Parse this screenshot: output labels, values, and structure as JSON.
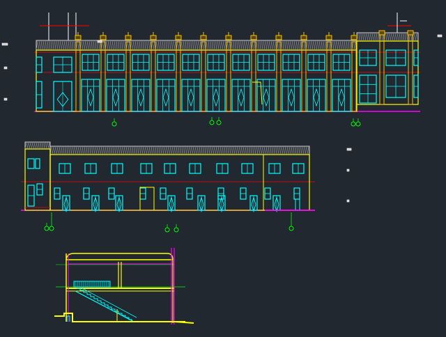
{
  "drawing": {
    "background": "#212830",
    "palette": {
      "wall": "#ffff00",
      "window": "#00ffff",
      "column": "#ffc000",
      "axis": "#ff0000",
      "ground": "#ff00ff",
      "roof": "#d0d0d0",
      "dim": "#00ff00",
      "text": "#ffffff"
    }
  },
  "views": {
    "front_elevation": {
      "front_bays": 11,
      "side_bays": 2,
      "axis_markers": [
        "1",
        "2",
        "3",
        "4",
        "5"
      ]
    },
    "rear_elevation": {
      "upper_windows": 10,
      "door_groups": 9,
      "axis_markers": [
        "1",
        "2",
        "3",
        "4"
      ]
    },
    "section": {
      "floors": 2,
      "stair_flights": 2
    }
  }
}
